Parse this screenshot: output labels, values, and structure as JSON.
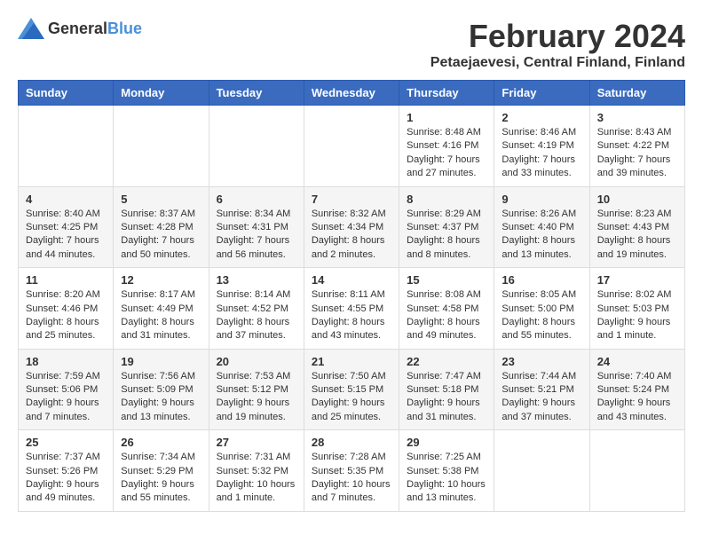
{
  "logo": {
    "text_general": "General",
    "text_blue": "Blue"
  },
  "title": "February 2024",
  "subtitle": "Petaejaevesi, Central Finland, Finland",
  "days_of_week": [
    "Sunday",
    "Monday",
    "Tuesday",
    "Wednesday",
    "Thursday",
    "Friday",
    "Saturday"
  ],
  "weeks": [
    [
      {
        "day": "",
        "content": ""
      },
      {
        "day": "",
        "content": ""
      },
      {
        "day": "",
        "content": ""
      },
      {
        "day": "",
        "content": ""
      },
      {
        "day": "1",
        "content": "Sunrise: 8:48 AM\nSunset: 4:16 PM\nDaylight: 7 hours and 27 minutes."
      },
      {
        "day": "2",
        "content": "Sunrise: 8:46 AM\nSunset: 4:19 PM\nDaylight: 7 hours and 33 minutes."
      },
      {
        "day": "3",
        "content": "Sunrise: 8:43 AM\nSunset: 4:22 PM\nDaylight: 7 hours and 39 minutes."
      }
    ],
    [
      {
        "day": "4",
        "content": "Sunrise: 8:40 AM\nSunset: 4:25 PM\nDaylight: 7 hours and 44 minutes."
      },
      {
        "day": "5",
        "content": "Sunrise: 8:37 AM\nSunset: 4:28 PM\nDaylight: 7 hours and 50 minutes."
      },
      {
        "day": "6",
        "content": "Sunrise: 8:34 AM\nSunset: 4:31 PM\nDaylight: 7 hours and 56 minutes."
      },
      {
        "day": "7",
        "content": "Sunrise: 8:32 AM\nSunset: 4:34 PM\nDaylight: 8 hours and 2 minutes."
      },
      {
        "day": "8",
        "content": "Sunrise: 8:29 AM\nSunset: 4:37 PM\nDaylight: 8 hours and 8 minutes."
      },
      {
        "day": "9",
        "content": "Sunrise: 8:26 AM\nSunset: 4:40 PM\nDaylight: 8 hours and 13 minutes."
      },
      {
        "day": "10",
        "content": "Sunrise: 8:23 AM\nSunset: 4:43 PM\nDaylight: 8 hours and 19 minutes."
      }
    ],
    [
      {
        "day": "11",
        "content": "Sunrise: 8:20 AM\nSunset: 4:46 PM\nDaylight: 8 hours and 25 minutes."
      },
      {
        "day": "12",
        "content": "Sunrise: 8:17 AM\nSunset: 4:49 PM\nDaylight: 8 hours and 31 minutes."
      },
      {
        "day": "13",
        "content": "Sunrise: 8:14 AM\nSunset: 4:52 PM\nDaylight: 8 hours and 37 minutes."
      },
      {
        "day": "14",
        "content": "Sunrise: 8:11 AM\nSunset: 4:55 PM\nDaylight: 8 hours and 43 minutes."
      },
      {
        "day": "15",
        "content": "Sunrise: 8:08 AM\nSunset: 4:58 PM\nDaylight: 8 hours and 49 minutes."
      },
      {
        "day": "16",
        "content": "Sunrise: 8:05 AM\nSunset: 5:00 PM\nDaylight: 8 hours and 55 minutes."
      },
      {
        "day": "17",
        "content": "Sunrise: 8:02 AM\nSunset: 5:03 PM\nDaylight: 9 hours and 1 minute."
      }
    ],
    [
      {
        "day": "18",
        "content": "Sunrise: 7:59 AM\nSunset: 5:06 PM\nDaylight: 9 hours and 7 minutes."
      },
      {
        "day": "19",
        "content": "Sunrise: 7:56 AM\nSunset: 5:09 PM\nDaylight: 9 hours and 13 minutes."
      },
      {
        "day": "20",
        "content": "Sunrise: 7:53 AM\nSunset: 5:12 PM\nDaylight: 9 hours and 19 minutes."
      },
      {
        "day": "21",
        "content": "Sunrise: 7:50 AM\nSunset: 5:15 PM\nDaylight: 9 hours and 25 minutes."
      },
      {
        "day": "22",
        "content": "Sunrise: 7:47 AM\nSunset: 5:18 PM\nDaylight: 9 hours and 31 minutes."
      },
      {
        "day": "23",
        "content": "Sunrise: 7:44 AM\nSunset: 5:21 PM\nDaylight: 9 hours and 37 minutes."
      },
      {
        "day": "24",
        "content": "Sunrise: 7:40 AM\nSunset: 5:24 PM\nDaylight: 9 hours and 43 minutes."
      }
    ],
    [
      {
        "day": "25",
        "content": "Sunrise: 7:37 AM\nSunset: 5:26 PM\nDaylight: 9 hours and 49 minutes."
      },
      {
        "day": "26",
        "content": "Sunrise: 7:34 AM\nSunset: 5:29 PM\nDaylight: 9 hours and 55 minutes."
      },
      {
        "day": "27",
        "content": "Sunrise: 7:31 AM\nSunset: 5:32 PM\nDaylight: 10 hours and 1 minute."
      },
      {
        "day": "28",
        "content": "Sunrise: 7:28 AM\nSunset: 5:35 PM\nDaylight: 10 hours and 7 minutes."
      },
      {
        "day": "29",
        "content": "Sunrise: 7:25 AM\nSunset: 5:38 PM\nDaylight: 10 hours and 13 minutes."
      },
      {
        "day": "",
        "content": ""
      },
      {
        "day": "",
        "content": ""
      }
    ]
  ]
}
